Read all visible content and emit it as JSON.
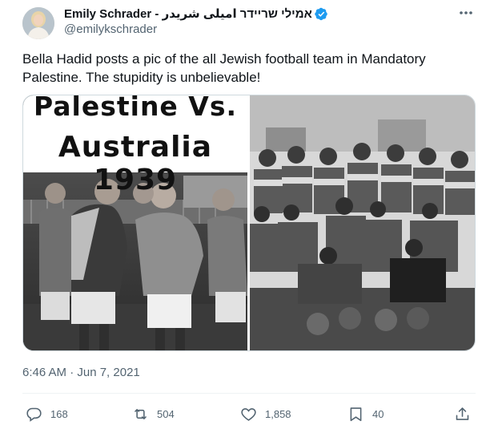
{
  "author": {
    "display_name": "Emily Schrader - אמילי שריידר اميلى شريدر",
    "handle": "@emilykschrader",
    "verified": true
  },
  "tweet": {
    "text": "Bella Hadid posts a pic of the all Jewish football team in Mandatory Palestine. The stupidity is unbelievable!",
    "timestamp": "6:46 AM · Jun 7, 2021"
  },
  "media": {
    "left_image_caption_line1": "Palestine Vs.",
    "left_image_caption_line2": "Australia 1939"
  },
  "actions": {
    "replies": "168",
    "retweets": "504",
    "likes": "1,858",
    "bookmarks": "40"
  },
  "icons": {
    "verified": "verified-badge-icon",
    "more": "more-options-icon",
    "reply": "reply-icon",
    "retweet": "retweet-icon",
    "like": "heart-icon",
    "bookmark": "bookmark-icon",
    "share": "share-icon"
  },
  "colors": {
    "verified_blue": "#1d9bf0",
    "text_primary": "#0f1419",
    "text_secondary": "#536471"
  }
}
